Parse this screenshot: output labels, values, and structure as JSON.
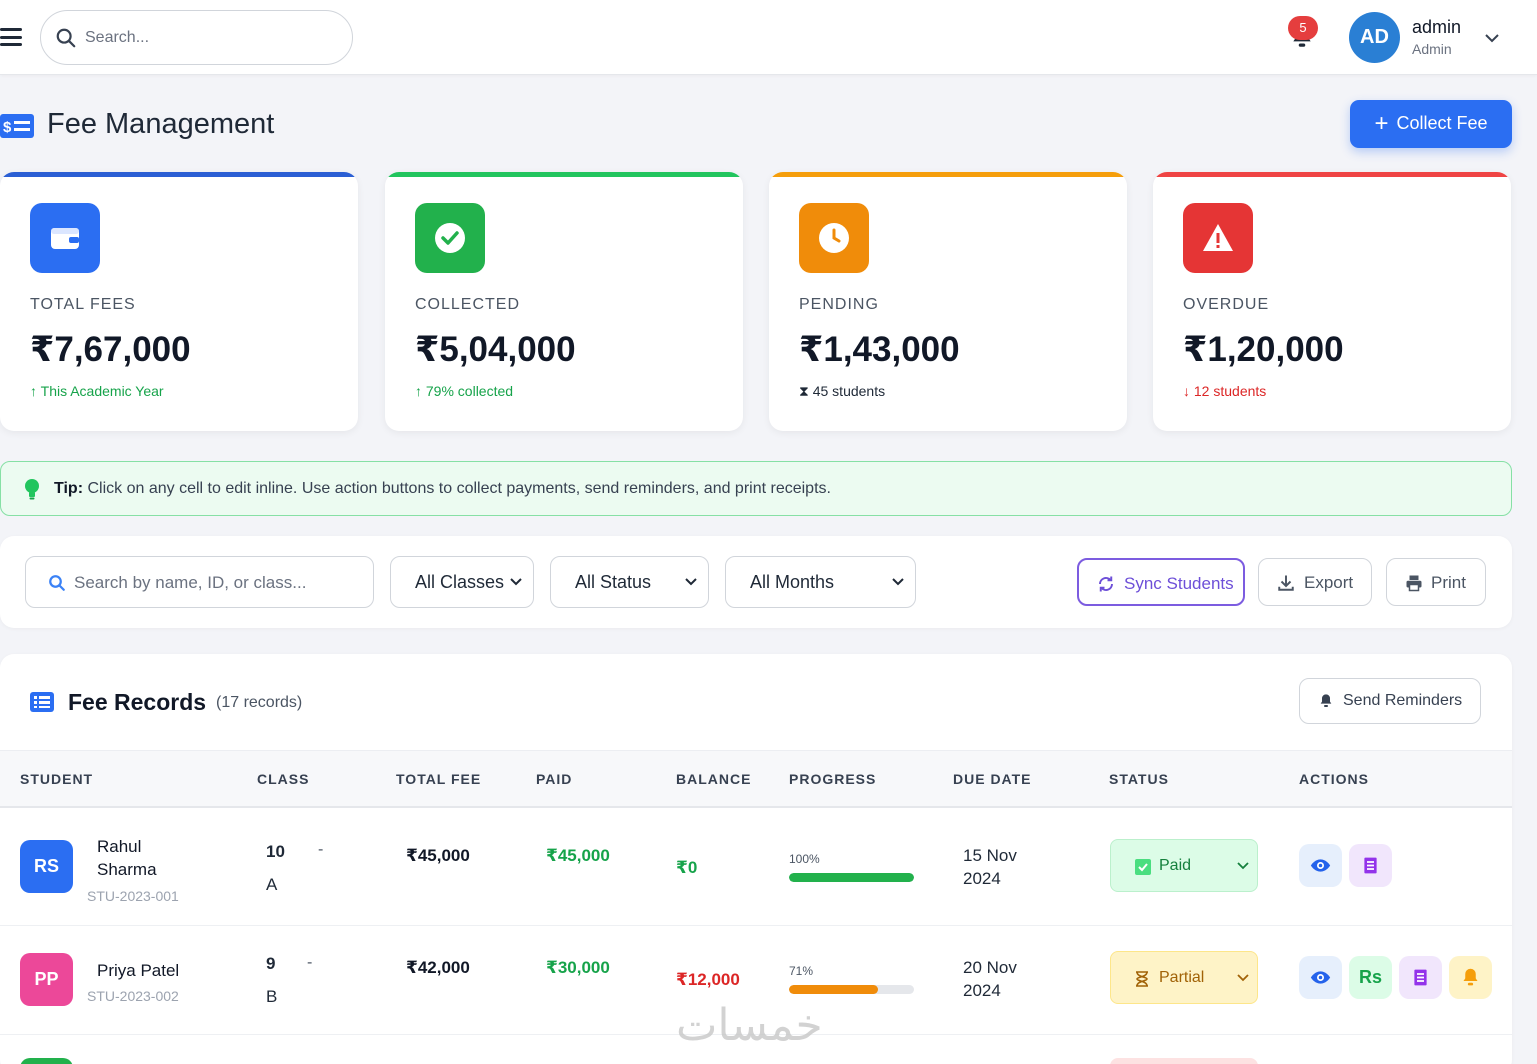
{
  "topbar": {
    "search_placeholder": "Search...",
    "notification_count": "5",
    "user_initials": "AD",
    "user_name": "admin",
    "user_role": "Admin"
  },
  "header": {
    "title": "Fee Management",
    "collect_button": "Collect Fee"
  },
  "stats": [
    {
      "label": "TOTAL FEES",
      "value": "₹7,67,000",
      "note": "This Academic Year",
      "color": "#2b6ef2",
      "note_color": "#16a34a",
      "icon": "wallet-icon"
    },
    {
      "label": "COLLECTED",
      "value": "₹5,04,000",
      "note": "79% collected",
      "color": "#22c55e",
      "note_color": "#16a34a",
      "icon": "check-circle-icon"
    },
    {
      "label": "PENDING",
      "value": "₹1,43,000",
      "note": "45 students",
      "color": "#f59e0b",
      "note_color": "#1f2937",
      "icon": "clock-icon"
    },
    {
      "label": "OVERDUE",
      "value": "₹1,20,000",
      "note": "12 students",
      "color": "#ef4444",
      "note_color": "#dc2626",
      "icon": "warning-icon"
    }
  ],
  "tip": {
    "label": "Tip:",
    "text": "Click on any cell to edit inline. Use action buttons to collect payments, send reminders, and print receipts."
  },
  "filters": {
    "search_placeholder": "Search by name, ID, or class...",
    "class_select": "All Classes",
    "status_select": "All Status",
    "month_select": "All Months",
    "sync_button": "Sync Students",
    "export_button": "Export",
    "print_button": "Print"
  },
  "records": {
    "title": "Fee Records",
    "count": "(17 records)",
    "reminders_button": "Send Reminders",
    "columns": [
      "STUDENT",
      "CLASS",
      "TOTAL FEE",
      "PAID",
      "BALANCE",
      "PROGRESS",
      "DUE DATE",
      "STATUS",
      "ACTIONS"
    ],
    "rows": [
      {
        "initials": "RS",
        "name": "Rahul Sharma",
        "id": "STU-2023-001",
        "class": "10",
        "section": "A",
        "dash": "-",
        "total": "₹45,000",
        "paid": "₹45,000",
        "balance": "₹0",
        "progress_label": "100%",
        "progress": 1.0,
        "due": "15 Nov 2024",
        "status": "Paid"
      },
      {
        "initials": "PP",
        "name": "Priya Patel",
        "id": "STU-2023-002",
        "class": "9",
        "section": "B",
        "dash": "-",
        "total": "₹42,000",
        "paid": "₹30,000",
        "balance": "₹12,000",
        "progress_label": "71%",
        "progress": 0.71,
        "due": "20 Nov 2024",
        "status": "Partial"
      }
    ]
  },
  "watermark": "خمسات"
}
